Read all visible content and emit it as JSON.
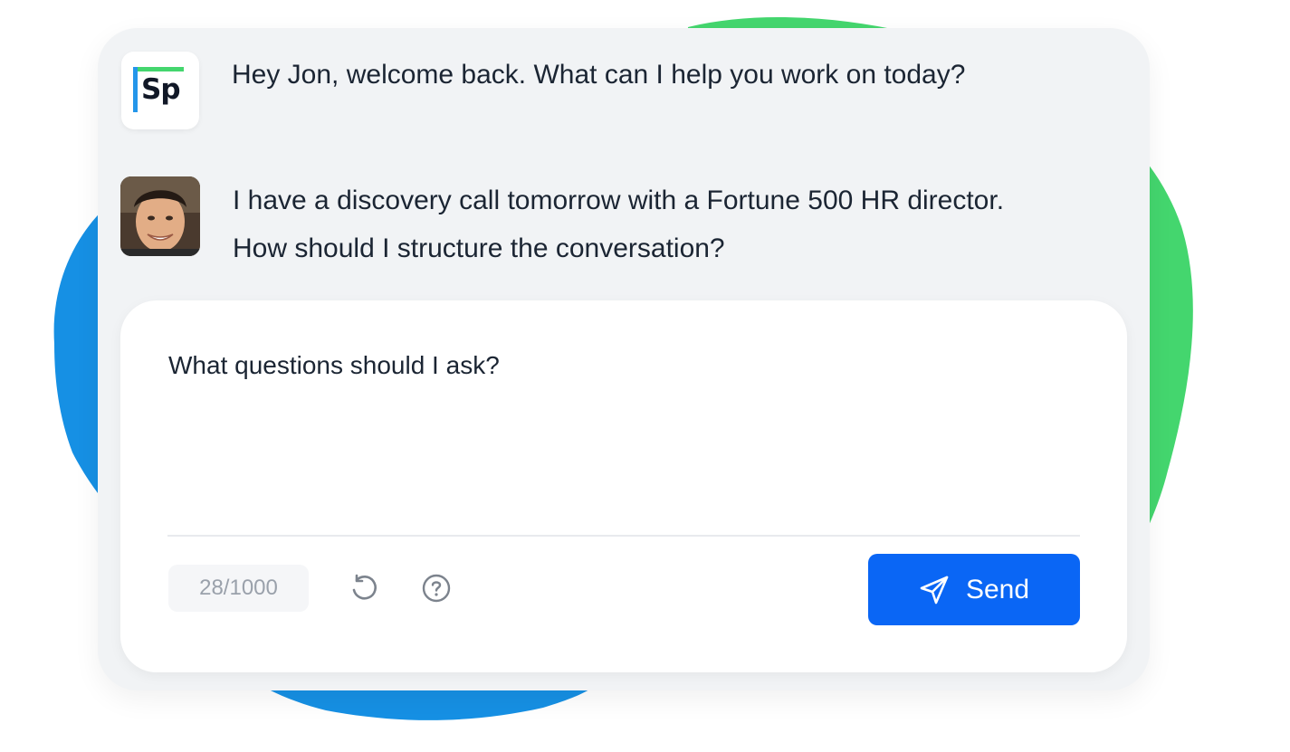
{
  "chat": {
    "bot_logo_text": "Sp",
    "bot_message": "Hey Jon, welcome back. What can I help you work on today?",
    "user_message_line1": "I have a discovery call tomorrow with a Fortune 500 HR director.",
    "user_message_line2": "How should I structure the conversation?"
  },
  "composer": {
    "input_value": "What questions should I ask?",
    "char_count": "28/1000",
    "send_label": "Send"
  },
  "icons": {
    "reset": "refresh-icon",
    "help": "help-circle-icon",
    "send": "paper-plane-icon"
  },
  "colors": {
    "brand_green": "#44d66e",
    "brand_blue": "#2496ea",
    "send_button": "#0a66f5",
    "card_bg": "#f1f3f5"
  }
}
